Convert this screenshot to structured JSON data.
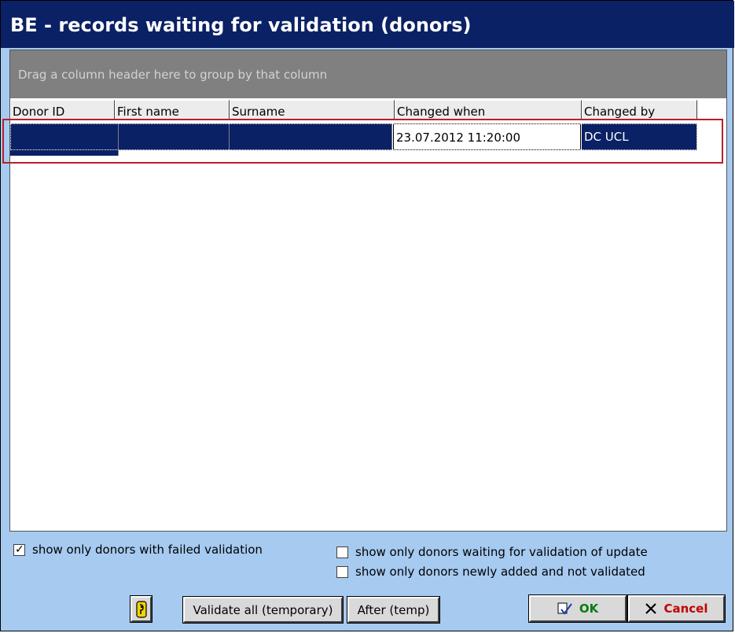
{
  "window": {
    "title": "BE - records waiting for validation (donors)"
  },
  "grid": {
    "group_by_hint": "Drag a column header here to group by that column",
    "columns": [
      "Donor ID",
      "First name",
      "Surname",
      "Changed when",
      "Changed by"
    ],
    "rows": [
      {
        "donor_id": "",
        "first_name": "",
        "surname": "",
        "changed_when": "23.07.2012 11:20:00",
        "changed_by": "DC UCL"
      }
    ]
  },
  "filters": {
    "failed_validation": {
      "label": "show only donors with failed validation",
      "checked": true
    },
    "waiting_update": {
      "label": "show only donors waiting for validation of update",
      "checked": false
    },
    "newly_added": {
      "label": "show only donors newly added and not validated",
      "checked": false
    }
  },
  "buttons": {
    "key_icon": "key-icon",
    "validate_all": "Validate all (temporary)",
    "after_temp": "After (temp)",
    "ok": "OK",
    "cancel": "Cancel"
  },
  "colors": {
    "title_bg": "#0b2165",
    "selection_bg": "#0b2165",
    "panel_bg": "#a6caf0",
    "highlight": "#b8202a",
    "ok": "#0a7a12",
    "cancel": "#c00000"
  }
}
